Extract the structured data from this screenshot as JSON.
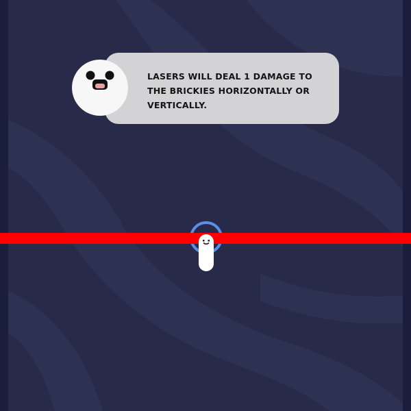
{
  "tutorial": {
    "message": "LASERS WILL DEAL 1 DAMAGE TO THE BRICKIES HORIZONTALLY OR VERTICALLY."
  },
  "icons": {
    "avatar": "smiling-face-icon",
    "player": "brickie-character-icon"
  },
  "colors": {
    "background": "#272a48",
    "background_wave": "#2d3152",
    "speech_bubble": "#d3d3d5",
    "laser": "#ff0000",
    "player_ring": "#5b8fe6",
    "player_body": "#ffffff",
    "text": "#141414"
  }
}
